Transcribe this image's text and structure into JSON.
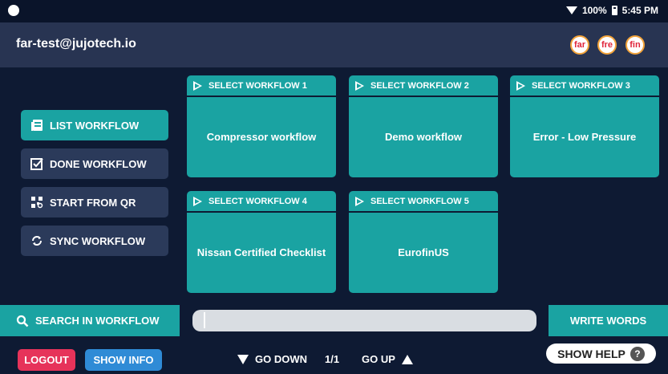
{
  "status": {
    "battery": "100%",
    "time": "5:45 PM"
  },
  "header": {
    "email": "far-test@jujotech.io",
    "brands": [
      "far",
      "fre",
      "fin"
    ]
  },
  "sidebar": {
    "items": [
      {
        "label": "LIST WORKFLOW",
        "icon": "list-icon",
        "active": true
      },
      {
        "label": "DONE WORKFLOW",
        "icon": "checkbox-icon",
        "active": false
      },
      {
        "label": "START FROM QR",
        "icon": "qr-icon",
        "active": false
      },
      {
        "label": "SYNC WORKFLOW",
        "icon": "sync-icon",
        "active": false
      }
    ]
  },
  "workflows": [
    {
      "header": "SELECT WORKFLOW 1",
      "title": "Compressor workflow"
    },
    {
      "header": "SELECT WORKFLOW 2",
      "title": "Demo workflow"
    },
    {
      "header": "SELECT WORKFLOW 3",
      "title": "Error - Low Pressure"
    },
    {
      "header": "SELECT WORKFLOW 4",
      "title": "Nissan Certified Checklist"
    },
    {
      "header": "SELECT WORKFLOW 5",
      "title": "EurofinUS"
    }
  ],
  "search": {
    "label": "SEARCH IN WORKFLOW",
    "value": "",
    "write_label": "WRITE WORDS"
  },
  "footer": {
    "logout": "LOGOUT",
    "show_info": "SHOW INFO",
    "go_down": "GO DOWN",
    "page": "1/1",
    "go_up": "GO UP",
    "show_help": "SHOW HELP",
    "help_glyph": "?"
  },
  "colors": {
    "teal": "#1aa3a2",
    "navy": "#0e1a33",
    "header": "#283452",
    "logout": "#e6335a",
    "info": "#2f8bd6"
  }
}
